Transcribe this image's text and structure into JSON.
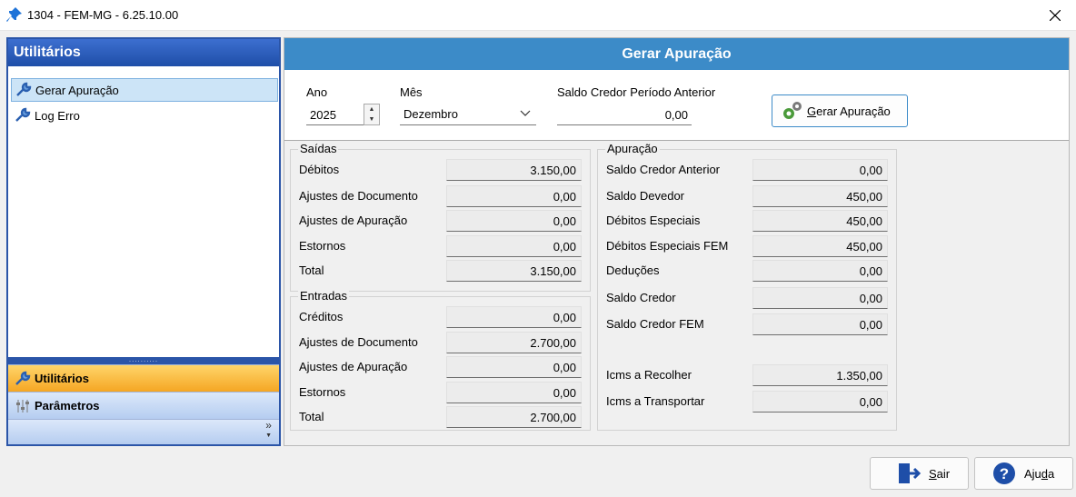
{
  "window": {
    "title": "1304 - FEM-MG - 6.25.10.00"
  },
  "nav": {
    "header": "Utilitários",
    "items": [
      {
        "label": "Gerar Apuração",
        "selected": true
      },
      {
        "label": "Log Erro",
        "selected": false
      }
    ],
    "splitter_dots": "..........",
    "buttons": [
      {
        "label": "Utilitários",
        "icon": "wrench-icon",
        "active": true
      },
      {
        "label": "Parâmetros",
        "icon": "sliders-icon",
        "active": false
      }
    ],
    "overflow_glyph": "»"
  },
  "panel": {
    "title": "Gerar Apuração",
    "ano_label": "Ano",
    "ano_value": "2025",
    "mes_label": "Mês",
    "mes_value": "Dezembro",
    "saldo_label": "Saldo Credor Período Anterior",
    "saldo_value": "0,00",
    "gerar_button_prefix": "G",
    "gerar_button_rest": "erar Apuração"
  },
  "saidas": {
    "title": "Saídas",
    "rows": [
      {
        "label": "Débitos",
        "value": "3.150,00"
      },
      {
        "label": "Ajustes de Documento",
        "value": "0,00"
      },
      {
        "label": "Ajustes de Apuração",
        "value": "0,00"
      },
      {
        "label": "Estornos",
        "value": "0,00"
      },
      {
        "label": "Total",
        "value": "3.150,00"
      }
    ]
  },
  "entradas": {
    "title": "Entradas",
    "rows": [
      {
        "label": "Créditos",
        "value": "0,00"
      },
      {
        "label": "Ajustes de Documento",
        "value": "2.700,00"
      },
      {
        "label": "Ajustes de Apuração",
        "value": "0,00"
      },
      {
        "label": "Estornos",
        "value": "0,00"
      },
      {
        "label": "Total",
        "value": "2.700,00"
      }
    ]
  },
  "apuracao": {
    "title": "Apuração",
    "rows": [
      {
        "label": "Saldo Credor Anterior",
        "value": "0,00"
      },
      {
        "label": "Saldo Devedor",
        "value": "450,00"
      },
      {
        "label": "Débitos Especiais",
        "value": "450,00"
      },
      {
        "label": "Débitos Especiais FEM",
        "value": "450,00"
      },
      {
        "label": "Deduções",
        "value": "0,00"
      },
      {
        "label": "Saldo Credor",
        "value": "0,00"
      },
      {
        "label": "Saldo Credor FEM",
        "value": "0,00"
      },
      {
        "label": "Icms a Recolher",
        "value": "1.350,00"
      },
      {
        "label": "Icms a Transportar",
        "value": "0,00"
      }
    ]
  },
  "footer": {
    "sair_prefix": "S",
    "sair_rest": "air",
    "ajuda_prefix": "Aju",
    "ajuda_underline": "d",
    "ajuda_rest": "a"
  },
  "colors": {
    "header_blue": "#3c8bc8",
    "nav_blue": "#2b55a8",
    "active_orange": "#f5a623"
  }
}
